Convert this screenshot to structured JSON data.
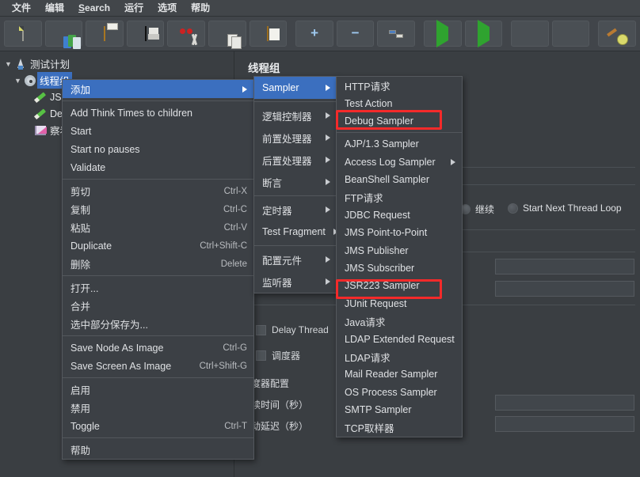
{
  "menubar": {
    "items": [
      {
        "label": "文件"
      },
      {
        "label": "编辑"
      },
      {
        "label": "Search",
        "mnemonic": "S"
      },
      {
        "label": "运行"
      },
      {
        "label": "选项"
      },
      {
        "label": "帮助"
      }
    ]
  },
  "toolbar": {
    "buttons": [
      {
        "name": "new-button",
        "icon": "new-document-icon"
      },
      {
        "name": "templates-button",
        "icon": "templates-icon"
      },
      {
        "name": "open-button",
        "icon": "open-folder-icon"
      },
      {
        "name": "save-button",
        "icon": "save-floppy-icon"
      },
      {
        "name": "cut-button",
        "icon": "scissors-icon"
      },
      {
        "name": "copy-button",
        "icon": "copy-icon"
      },
      {
        "name": "paste-button",
        "icon": "clipboard-icon"
      },
      {
        "name": "expand-all-button",
        "icon": "plus-icon",
        "glyph": "+"
      },
      {
        "name": "collapse-all-button",
        "icon": "minus-icon",
        "glyph": "−"
      },
      {
        "name": "toggle-button",
        "icon": "toggle-icon"
      },
      {
        "name": "start-button",
        "icon": "play-green-icon"
      },
      {
        "name": "start-no-pauses-button",
        "icon": "play-no-pauses-icon"
      },
      {
        "name": "stop-button",
        "icon": "stop-circle-icon"
      },
      {
        "name": "shutdown-button",
        "icon": "shutdown-circle-icon"
      },
      {
        "name": "clear-all-button",
        "icon": "clear-broom-icon"
      }
    ]
  },
  "tree": {
    "nodes": [
      {
        "label": "测试计划",
        "icon": "test-plan-icon",
        "expanded": true,
        "depth": 0,
        "selected": false
      },
      {
        "label": "线程组",
        "icon": "thread-group-gear-icon",
        "expanded": true,
        "depth": 1,
        "selected": true
      },
      {
        "label": "JSR",
        "icon": "jsr223-pencil-icon",
        "depth": 2,
        "selected": false
      },
      {
        "label": "Deb",
        "icon": "debug-sampler-pencil-icon",
        "depth": 2,
        "selected": false
      },
      {
        "label": "察看",
        "icon": "view-results-tree-icon",
        "depth": 2,
        "selected": false
      }
    ]
  },
  "main_panel": {
    "title": "线程组",
    "action_label": "继续",
    "next_loop_label": "Start Next Thread Loop",
    "delay_thread_label": "Delay Thread",
    "scheduler_label": "调度器",
    "scheduler_config_label": "调度器配置",
    "duration_label": "持续时间（秒）",
    "startup_delay_label": "启动延迟（秒）"
  },
  "context_menu": {
    "items": [
      {
        "label": "添加",
        "selected": true,
        "submenu": true,
        "shortcut": ""
      },
      {
        "divider": true
      },
      {
        "label": "Add Think Times to children",
        "shortcut": ""
      },
      {
        "label": "Start",
        "shortcut": ""
      },
      {
        "label": "Start no pauses",
        "shortcut": ""
      },
      {
        "label": "Validate",
        "shortcut": ""
      },
      {
        "divider": true
      },
      {
        "label": "剪切",
        "shortcut": "Ctrl-X"
      },
      {
        "label": "复制",
        "shortcut": "Ctrl-C"
      },
      {
        "label": "粘贴",
        "shortcut": "Ctrl-V"
      },
      {
        "label": "Duplicate",
        "shortcut": "Ctrl+Shift-C"
      },
      {
        "label": "删除",
        "shortcut": "Delete"
      },
      {
        "divider": true
      },
      {
        "label": "打开...",
        "shortcut": ""
      },
      {
        "label": "合并",
        "shortcut": ""
      },
      {
        "label": "选中部分保存为...",
        "shortcut": ""
      },
      {
        "divider": true
      },
      {
        "label": "Save Node As Image",
        "shortcut": "Ctrl-G"
      },
      {
        "label": "Save Screen As Image",
        "shortcut": "Ctrl+Shift-G"
      },
      {
        "divider": true
      },
      {
        "label": "启用",
        "shortcut": ""
      },
      {
        "label": "禁用",
        "shortcut": ""
      },
      {
        "label": "Toggle",
        "shortcut": "Ctrl-T"
      },
      {
        "divider": true
      },
      {
        "label": "帮助",
        "shortcut": ""
      }
    ]
  },
  "add_submenu": {
    "items": [
      {
        "label": "Sampler",
        "selected": true,
        "submenu": true
      },
      {
        "divider": true
      },
      {
        "label": "逻辑控制器",
        "submenu": true
      },
      {
        "label": "前置处理器",
        "submenu": true
      },
      {
        "label": "后置处理器",
        "submenu": true
      },
      {
        "label": "断言",
        "submenu": true
      },
      {
        "divider": true
      },
      {
        "label": "定时器",
        "submenu": true
      },
      {
        "label": "Test Fragment",
        "submenu": true
      },
      {
        "divider": true
      },
      {
        "label": "配置元件",
        "submenu": true
      },
      {
        "label": "监听器",
        "submenu": true
      }
    ]
  },
  "sampler_submenu": {
    "items": [
      {
        "label": "HTTP请求",
        "highlighted": false
      },
      {
        "label": "Test Action",
        "highlighted": false
      },
      {
        "label": "Debug Sampler",
        "highlighted": true
      },
      {
        "divider": true
      },
      {
        "label": "AJP/1.3 Sampler",
        "highlighted": false
      },
      {
        "label": "Access Log Sampler",
        "highlighted": false,
        "submenu": true
      },
      {
        "label": "BeanShell Sampler",
        "highlighted": false
      },
      {
        "label": "FTP请求",
        "highlighted": false
      },
      {
        "label": "JDBC Request",
        "highlighted": false
      },
      {
        "label": "JMS Point-to-Point",
        "highlighted": false
      },
      {
        "label": "JMS Publisher",
        "highlighted": false
      },
      {
        "label": "JMS Subscriber",
        "highlighted": false
      },
      {
        "label": "JSR223 Sampler",
        "highlighted": true
      },
      {
        "label": "JUnit Request",
        "highlighted": false
      },
      {
        "label": "Java请求",
        "highlighted": false
      },
      {
        "label": "LDAP Extended Request",
        "highlighted": false
      },
      {
        "label": "LDAP请求",
        "highlighted": false
      },
      {
        "label": "Mail Reader Sampler",
        "highlighted": false
      },
      {
        "label": "OS Process Sampler",
        "highlighted": false
      },
      {
        "label": "SMTP Sampler",
        "highlighted": false
      },
      {
        "label": "TCP取样器",
        "highlighted": false
      }
    ]
  },
  "colors": {
    "highlight_red": "#f42a2a",
    "menu_selection_blue": "#3b6fbf",
    "background": "#3a3e42",
    "panel": "#3c4045"
  }
}
